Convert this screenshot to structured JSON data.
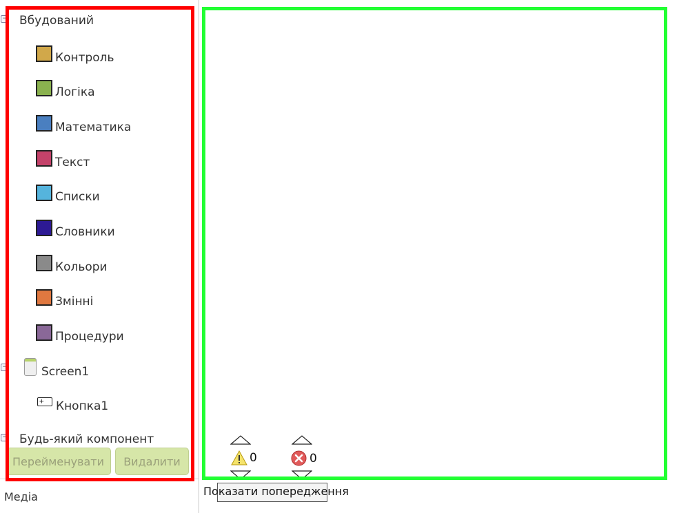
{
  "blocks_panel": {
    "builtin_heading": "Вбудований",
    "builtin_items": [
      {
        "label": "Контроль",
        "color": "#d1a84a"
      },
      {
        "label": "Логіка",
        "color": "#8ab14f"
      },
      {
        "label": "Математика",
        "color": "#4a7fc0"
      },
      {
        "label": "Текст",
        "color": "#c4426a"
      },
      {
        "label": "Списки",
        "color": "#55b4dd"
      },
      {
        "label": "Словники",
        "color": "#2d1a94"
      },
      {
        "label": "Кольори",
        "color": "#8a8a8a"
      },
      {
        "label": "Змінні",
        "color": "#e07840"
      },
      {
        "label": "Процедури",
        "color": "#8a6898"
      }
    ],
    "screen_label": "Screen1",
    "component_label": "Кнопка1",
    "any_component_heading": "Будь-який компонент",
    "rename_button": "Перейменувати",
    "delete_button": "Видалити",
    "toggle_symbol": "−",
    "component_icon_symbol": "+"
  },
  "media_label": "Медіа",
  "workspace": {
    "warnings_count": "0",
    "errors_count": "0",
    "show_warnings_tooltip": "Показати попередження"
  },
  "colors": {
    "highlight_left": "#ff0000",
    "highlight_right": "#22ff33",
    "button_bg": "#d6e6a8"
  }
}
